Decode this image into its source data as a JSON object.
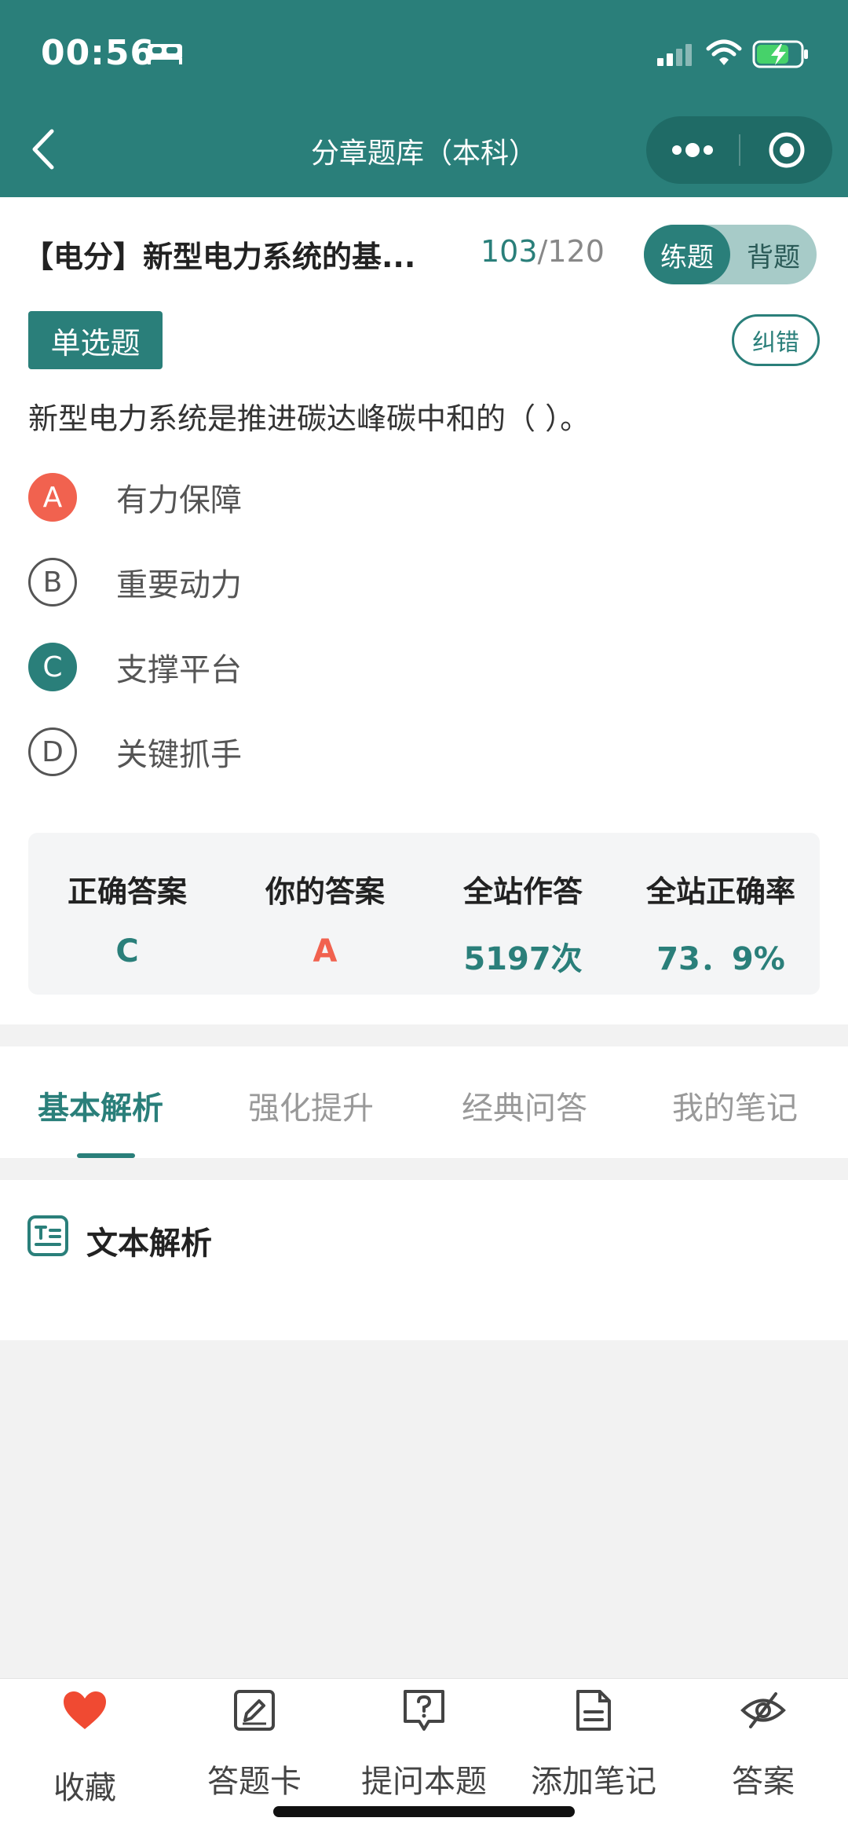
{
  "status_bar": {
    "time": "00:56"
  },
  "nav": {
    "title": "分章题库（本科）"
  },
  "question_header": {
    "title": "【电分】新型电力系统的基...",
    "current": "103",
    "total": "/120",
    "mode_practice": "练题",
    "mode_memorize": "背题"
  },
  "question": {
    "type": "单选题",
    "report_error": "纠错",
    "text": "新型电力系统是推进碳达峰碳中和的（ ）。",
    "options": [
      {
        "letter": "A",
        "text": "有力保障",
        "state": "wrong"
      },
      {
        "letter": "B",
        "text": "重要动力",
        "state": "normal"
      },
      {
        "letter": "C",
        "text": "支撑平台",
        "state": "right"
      },
      {
        "letter": "D",
        "text": "关键抓手",
        "state": "normal"
      }
    ]
  },
  "stats": {
    "correct_answer_label": "正确答案",
    "correct_answer": "C",
    "your_answer_label": "你的答案",
    "your_answer": "A",
    "site_answers_label": "全站作答",
    "site_answers": "5197次",
    "site_accuracy_label": "全站正确率",
    "site_accuracy": "73．9%"
  },
  "tabs": [
    "基本解析",
    "强化提升",
    "经典问答",
    "我的笔记"
  ],
  "analysis": {
    "title": "文本解析"
  },
  "bottom_bar": {
    "favorite": "收藏",
    "answer_card": "答题卡",
    "ask": "提问本题",
    "add_note": "添加笔记",
    "answer": "答案"
  },
  "colors": {
    "primary": "#2a7f7a",
    "wrong": "#f1624f",
    "favorite": "#f04a32"
  }
}
